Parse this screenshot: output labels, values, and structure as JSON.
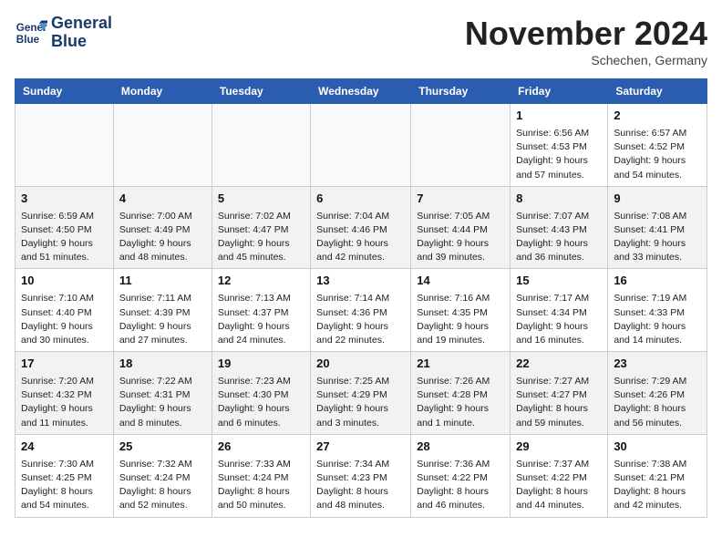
{
  "logo": {
    "line1": "General",
    "line2": "Blue"
  },
  "title": "November 2024",
  "subtitle": "Schechen, Germany",
  "weekdays": [
    "Sunday",
    "Monday",
    "Tuesday",
    "Wednesday",
    "Thursday",
    "Friday",
    "Saturday"
  ],
  "weeks": [
    [
      {
        "day": "",
        "info": ""
      },
      {
        "day": "",
        "info": ""
      },
      {
        "day": "",
        "info": ""
      },
      {
        "day": "",
        "info": ""
      },
      {
        "day": "",
        "info": ""
      },
      {
        "day": "1",
        "info": "Sunrise: 6:56 AM\nSunset: 4:53 PM\nDaylight: 9 hours and 57 minutes."
      },
      {
        "day": "2",
        "info": "Sunrise: 6:57 AM\nSunset: 4:52 PM\nDaylight: 9 hours and 54 minutes."
      }
    ],
    [
      {
        "day": "3",
        "info": "Sunrise: 6:59 AM\nSunset: 4:50 PM\nDaylight: 9 hours and 51 minutes."
      },
      {
        "day": "4",
        "info": "Sunrise: 7:00 AM\nSunset: 4:49 PM\nDaylight: 9 hours and 48 minutes."
      },
      {
        "day": "5",
        "info": "Sunrise: 7:02 AM\nSunset: 4:47 PM\nDaylight: 9 hours and 45 minutes."
      },
      {
        "day": "6",
        "info": "Sunrise: 7:04 AM\nSunset: 4:46 PM\nDaylight: 9 hours and 42 minutes."
      },
      {
        "day": "7",
        "info": "Sunrise: 7:05 AM\nSunset: 4:44 PM\nDaylight: 9 hours and 39 minutes."
      },
      {
        "day": "8",
        "info": "Sunrise: 7:07 AM\nSunset: 4:43 PM\nDaylight: 9 hours and 36 minutes."
      },
      {
        "day": "9",
        "info": "Sunrise: 7:08 AM\nSunset: 4:41 PM\nDaylight: 9 hours and 33 minutes."
      }
    ],
    [
      {
        "day": "10",
        "info": "Sunrise: 7:10 AM\nSunset: 4:40 PM\nDaylight: 9 hours and 30 minutes."
      },
      {
        "day": "11",
        "info": "Sunrise: 7:11 AM\nSunset: 4:39 PM\nDaylight: 9 hours and 27 minutes."
      },
      {
        "day": "12",
        "info": "Sunrise: 7:13 AM\nSunset: 4:37 PM\nDaylight: 9 hours and 24 minutes."
      },
      {
        "day": "13",
        "info": "Sunrise: 7:14 AM\nSunset: 4:36 PM\nDaylight: 9 hours and 22 minutes."
      },
      {
        "day": "14",
        "info": "Sunrise: 7:16 AM\nSunset: 4:35 PM\nDaylight: 9 hours and 19 minutes."
      },
      {
        "day": "15",
        "info": "Sunrise: 7:17 AM\nSunset: 4:34 PM\nDaylight: 9 hours and 16 minutes."
      },
      {
        "day": "16",
        "info": "Sunrise: 7:19 AM\nSunset: 4:33 PM\nDaylight: 9 hours and 14 minutes."
      }
    ],
    [
      {
        "day": "17",
        "info": "Sunrise: 7:20 AM\nSunset: 4:32 PM\nDaylight: 9 hours and 11 minutes."
      },
      {
        "day": "18",
        "info": "Sunrise: 7:22 AM\nSunset: 4:31 PM\nDaylight: 9 hours and 8 minutes."
      },
      {
        "day": "19",
        "info": "Sunrise: 7:23 AM\nSunset: 4:30 PM\nDaylight: 9 hours and 6 minutes."
      },
      {
        "day": "20",
        "info": "Sunrise: 7:25 AM\nSunset: 4:29 PM\nDaylight: 9 hours and 3 minutes."
      },
      {
        "day": "21",
        "info": "Sunrise: 7:26 AM\nSunset: 4:28 PM\nDaylight: 9 hours and 1 minute."
      },
      {
        "day": "22",
        "info": "Sunrise: 7:27 AM\nSunset: 4:27 PM\nDaylight: 8 hours and 59 minutes."
      },
      {
        "day": "23",
        "info": "Sunrise: 7:29 AM\nSunset: 4:26 PM\nDaylight: 8 hours and 56 minutes."
      }
    ],
    [
      {
        "day": "24",
        "info": "Sunrise: 7:30 AM\nSunset: 4:25 PM\nDaylight: 8 hours and 54 minutes."
      },
      {
        "day": "25",
        "info": "Sunrise: 7:32 AM\nSunset: 4:24 PM\nDaylight: 8 hours and 52 minutes."
      },
      {
        "day": "26",
        "info": "Sunrise: 7:33 AM\nSunset: 4:24 PM\nDaylight: 8 hours and 50 minutes."
      },
      {
        "day": "27",
        "info": "Sunrise: 7:34 AM\nSunset: 4:23 PM\nDaylight: 8 hours and 48 minutes."
      },
      {
        "day": "28",
        "info": "Sunrise: 7:36 AM\nSunset: 4:22 PM\nDaylight: 8 hours and 46 minutes."
      },
      {
        "day": "29",
        "info": "Sunrise: 7:37 AM\nSunset: 4:22 PM\nDaylight: 8 hours and 44 minutes."
      },
      {
        "day": "30",
        "info": "Sunrise: 7:38 AM\nSunset: 4:21 PM\nDaylight: 8 hours and 42 minutes."
      }
    ]
  ]
}
